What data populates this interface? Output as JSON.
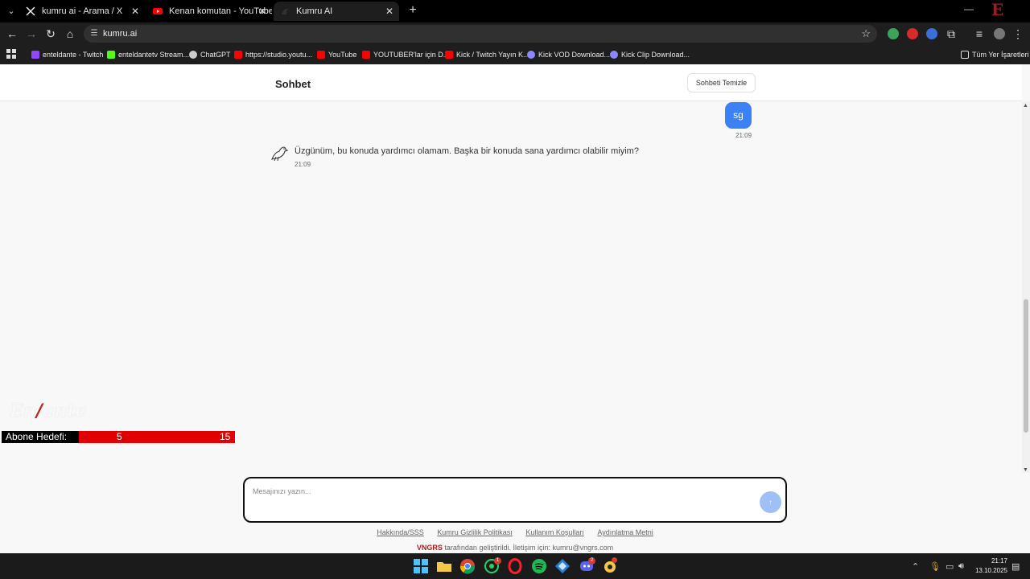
{
  "browser": {
    "tabs": [
      {
        "label": "kumru ai - Arama / X",
        "icon": "x-logo-icon",
        "active": false
      },
      {
        "label": "Kenan komutan - YouTube",
        "icon": "youtube-icon",
        "active": false
      },
      {
        "label": "Kumru AI",
        "icon": "kumru-icon",
        "active": true
      }
    ],
    "url": "kumru.ai",
    "bookmarks": [
      {
        "label": "enteldante - Twitch",
        "color": "#9146ff"
      },
      {
        "label": "enteldantetv Stream...",
        "color": "#53fc18"
      },
      {
        "label": "ChatGPT",
        "color": "#cccccc"
      },
      {
        "label": "https://studio.youtu...",
        "color": "#ff0000"
      },
      {
        "label": "YouTube",
        "color": "#ff0000"
      },
      {
        "label": "YOUTUBER'lar için D...",
        "color": "#ff0000"
      },
      {
        "label": "Kick / Twitch Yayın K...",
        "color": "#ff0000"
      },
      {
        "label": "Kick VOD Download...",
        "color": "#8888ff"
      },
      {
        "label": "Kick Clip Download...",
        "color": "#8888ff"
      }
    ],
    "all_bookmarks": "Tüm Yer İşaretleri"
  },
  "header": {
    "title": "Sohbet",
    "clear_button": "Sohbeti Temizle"
  },
  "messages": {
    "user": {
      "text": "sg",
      "time": "21:09"
    },
    "bot": {
      "text": "Üzgünüm, bu konuda yardımcı olamam. Başka bir konuda sana yardımcı olabilir miyim?",
      "time": "21:09"
    }
  },
  "overlay": {
    "goal_label": "Abone Hedefi:",
    "goal_current": "5",
    "goal_target": "15"
  },
  "composer": {
    "placeholder": "Mesajınızı yazın...",
    "send_icon": "send-arrow-icon"
  },
  "footer": {
    "links": [
      "Hakkında/SSS",
      "Kumru Gizlilik Politikası",
      "Kullanım Koşulları",
      "Aydınlatma Metni"
    ],
    "brand": "VNGRS",
    "credit": " tarafından geliştirildi. İletişim için: kumru@vngrs.com"
  },
  "taskbar": {
    "time": "21:17",
    "date": "13.10.2025",
    "whatsapp_badge": "1",
    "discord_badge": "2"
  },
  "colors": {
    "accent": "#3b82f6",
    "send_disabled": "#9ec0f5",
    "brand_red": "#b31b1b"
  }
}
